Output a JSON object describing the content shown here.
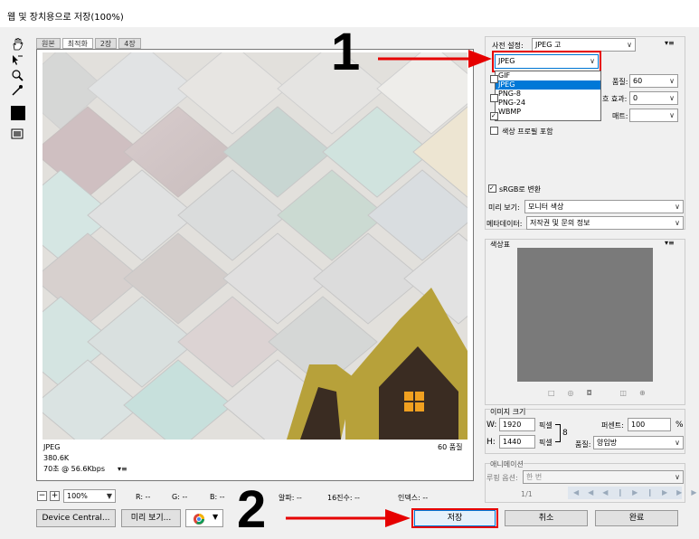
{
  "window": {
    "title": "웹 및 장치용으로 저장(100%)"
  },
  "tabs": [
    "원본",
    "최적화",
    "2장",
    "4장"
  ],
  "preview_info": {
    "format": "JPEG",
    "size": "380.6K",
    "time": "70초 @ 56.6Kbps",
    "quality_note": "60 품질"
  },
  "bottom_bar": {
    "zoom": "100%",
    "r": "R: --",
    "g": "G: --",
    "b": "B: --",
    "alpha": "알파: --",
    "hex": "16진수: --",
    "index": "인덱스: --"
  },
  "buttons": {
    "device_central": "Device Central...",
    "preview": "미리 보기...",
    "save": "저장",
    "cancel": "취소",
    "done": "완료"
  },
  "settings": {
    "preset_label": "사전 설정:",
    "preset_value": "JPEG 고",
    "format_value": "JPEG",
    "format_options": [
      "GIF",
      "JPEG",
      "PNG-8",
      "PNG-24",
      "WBMP"
    ],
    "format_selected_index": 1,
    "quality_label": "품질:",
    "quality_value": "60",
    "blur_label": "흐림 효과:",
    "blur_partial": "흐 효과:",
    "blur_value": "0",
    "matte_label": "매트:",
    "matte_value": "",
    "embed_color_profile": "색상 프로필 포함",
    "srgb_label": "sRGB로 변환",
    "srgb_checked": true,
    "preview_label": "미리 보기:",
    "preview_value": "모니터 색상",
    "metadata_label": "메타데이터:",
    "metadata_value": "저작권 및 문의 정보"
  },
  "color_table": {
    "title": "색상표"
  },
  "image_size": {
    "title": "이미지 크기",
    "w_label": "W:",
    "w_value": "1920",
    "w_unit": "픽셀",
    "h_label": "H:",
    "h_value": "1440",
    "h_unit": "픽셀",
    "percent_label": "퍼센트:",
    "percent_value": "100",
    "percent_unit": "%",
    "quality_label": "품질:",
    "quality_value": "양입방"
  },
  "animation": {
    "title": "애니메이션",
    "loop_label": "루핑 옵션:",
    "loop_value": "한 번",
    "frame": "1/1"
  },
  "annotations": {
    "step1": "1",
    "step2": "2"
  },
  "colors": {
    "dialog_bg": "#f0f0f0",
    "highlight": "#0078d7",
    "annotation_red": "#e60000",
    "tile_gold": "#b7a13a",
    "house_brown": "#3a2c22",
    "window_orange": "#f0a020"
  }
}
